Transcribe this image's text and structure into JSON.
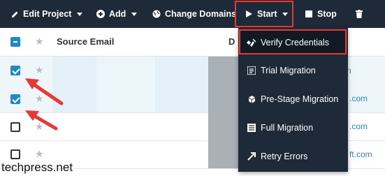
{
  "toolbar": {
    "edit_project": "Edit Project",
    "add": "Add",
    "change_domains": "Change Domains",
    "start": "Start",
    "stop": "Stop"
  },
  "table": {
    "col_source_email": "Source Email",
    "col_second_fragment": "D",
    "rows": [
      {
        "checked": true,
        "link_fragment": "n"
      },
      {
        "checked": true,
        "link_fragment": ".com"
      },
      {
        "checked": false,
        "link_fragment": ".com"
      },
      {
        "checked": false,
        "link_fragment": "ft.com"
      }
    ]
  },
  "menu": {
    "items": [
      {
        "label": "Verify Credentials",
        "icon": "verify-icon"
      },
      {
        "label": "Trial Migration",
        "icon": "list-icon"
      },
      {
        "label": "Pre-Stage Migration",
        "icon": "cubes-icon"
      },
      {
        "label": "Full Migration",
        "icon": "bars-icon"
      },
      {
        "label": "Retry Errors",
        "icon": "retry-arrow-icon"
      }
    ]
  },
  "watermark": "techpress.net",
  "colors": {
    "toolbar_bg": "#1e2a38",
    "highlight": "#e53935",
    "checkbox": "#1e88c8",
    "link": "#2a87c4"
  }
}
